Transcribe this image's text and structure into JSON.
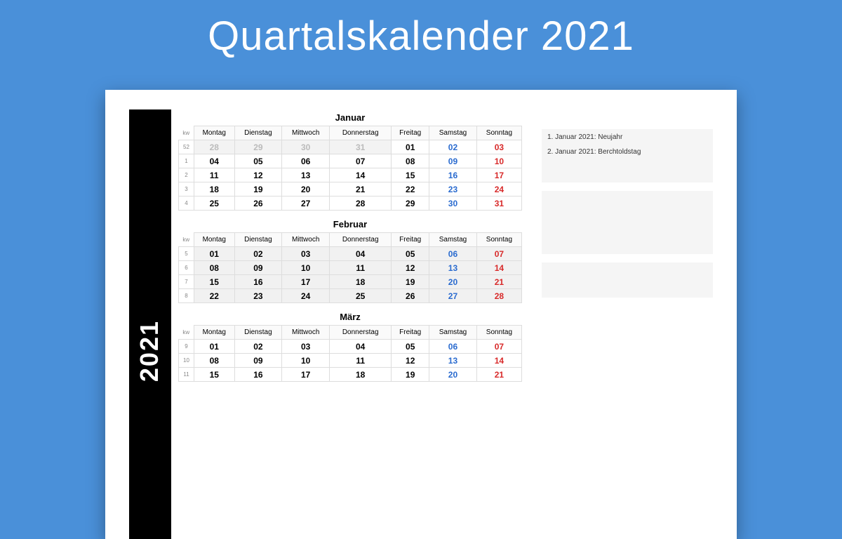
{
  "title": "Quartalskalender 2021",
  "year": "2021",
  "kw_label": "kw",
  "weekdays": [
    "Montag",
    "Dienstag",
    "Mittwoch",
    "Donnerstag",
    "Freitag",
    "Samstag",
    "Sonntag"
  ],
  "months": [
    {
      "name": "Januar",
      "weeks": [
        {
          "kw": "52",
          "days": [
            {
              "n": "28",
              "cls": "grey"
            },
            {
              "n": "29",
              "cls": "grey"
            },
            {
              "n": "30",
              "cls": "grey"
            },
            {
              "n": "31",
              "cls": "grey"
            },
            {
              "n": "01",
              "cls": ""
            },
            {
              "n": "02",
              "cls": "sat"
            },
            {
              "n": "03",
              "cls": "sun"
            }
          ]
        },
        {
          "kw": "1",
          "days": [
            {
              "n": "04",
              "cls": ""
            },
            {
              "n": "05",
              "cls": ""
            },
            {
              "n": "06",
              "cls": ""
            },
            {
              "n": "07",
              "cls": ""
            },
            {
              "n": "08",
              "cls": ""
            },
            {
              "n": "09",
              "cls": "sat"
            },
            {
              "n": "10",
              "cls": "sun"
            }
          ]
        },
        {
          "kw": "2",
          "days": [
            {
              "n": "11",
              "cls": ""
            },
            {
              "n": "12",
              "cls": ""
            },
            {
              "n": "13",
              "cls": ""
            },
            {
              "n": "14",
              "cls": ""
            },
            {
              "n": "15",
              "cls": ""
            },
            {
              "n": "16",
              "cls": "sat"
            },
            {
              "n": "17",
              "cls": "sun"
            }
          ]
        },
        {
          "kw": "3",
          "days": [
            {
              "n": "18",
              "cls": ""
            },
            {
              "n": "19",
              "cls": ""
            },
            {
              "n": "20",
              "cls": ""
            },
            {
              "n": "21",
              "cls": ""
            },
            {
              "n": "22",
              "cls": ""
            },
            {
              "n": "23",
              "cls": "sat"
            },
            {
              "n": "24",
              "cls": "sun"
            }
          ]
        },
        {
          "kw": "4",
          "days": [
            {
              "n": "25",
              "cls": ""
            },
            {
              "n": "26",
              "cls": ""
            },
            {
              "n": "27",
              "cls": ""
            },
            {
              "n": "28",
              "cls": ""
            },
            {
              "n": "29",
              "cls": ""
            },
            {
              "n": "30",
              "cls": "sat"
            },
            {
              "n": "31",
              "cls": "sun"
            }
          ]
        }
      ],
      "notes": [
        "1. Januar 2021: Neujahr",
        "2. Januar 2021: Berchtoldstag"
      ]
    },
    {
      "name": "Februar",
      "shaded": true,
      "weeks": [
        {
          "kw": "5",
          "days": [
            {
              "n": "01",
              "cls": ""
            },
            {
              "n": "02",
              "cls": ""
            },
            {
              "n": "03",
              "cls": ""
            },
            {
              "n": "04",
              "cls": ""
            },
            {
              "n": "05",
              "cls": ""
            },
            {
              "n": "06",
              "cls": "sat"
            },
            {
              "n": "07",
              "cls": "sun"
            }
          ]
        },
        {
          "kw": "6",
          "days": [
            {
              "n": "08",
              "cls": ""
            },
            {
              "n": "09",
              "cls": ""
            },
            {
              "n": "10",
              "cls": ""
            },
            {
              "n": "11",
              "cls": ""
            },
            {
              "n": "12",
              "cls": ""
            },
            {
              "n": "13",
              "cls": "sat"
            },
            {
              "n": "14",
              "cls": "sun"
            }
          ]
        },
        {
          "kw": "7",
          "days": [
            {
              "n": "15",
              "cls": ""
            },
            {
              "n": "16",
              "cls": ""
            },
            {
              "n": "17",
              "cls": ""
            },
            {
              "n": "18",
              "cls": ""
            },
            {
              "n": "19",
              "cls": ""
            },
            {
              "n": "20",
              "cls": "sat"
            },
            {
              "n": "21",
              "cls": "sun"
            }
          ]
        },
        {
          "kw": "8",
          "days": [
            {
              "n": "22",
              "cls": ""
            },
            {
              "n": "23",
              "cls": ""
            },
            {
              "n": "24",
              "cls": ""
            },
            {
              "n": "25",
              "cls": ""
            },
            {
              "n": "26",
              "cls": ""
            },
            {
              "n": "27",
              "cls": "sat"
            },
            {
              "n": "28",
              "cls": "sun"
            }
          ]
        }
      ],
      "notes": []
    },
    {
      "name": "März",
      "weeks": [
        {
          "kw": "9",
          "days": [
            {
              "n": "01",
              "cls": ""
            },
            {
              "n": "02",
              "cls": ""
            },
            {
              "n": "03",
              "cls": ""
            },
            {
              "n": "04",
              "cls": ""
            },
            {
              "n": "05",
              "cls": ""
            },
            {
              "n": "06",
              "cls": "sat"
            },
            {
              "n": "07",
              "cls": "sun"
            }
          ]
        },
        {
          "kw": "10",
          "days": [
            {
              "n": "08",
              "cls": ""
            },
            {
              "n": "09",
              "cls": ""
            },
            {
              "n": "10",
              "cls": ""
            },
            {
              "n": "11",
              "cls": ""
            },
            {
              "n": "12",
              "cls": ""
            },
            {
              "n": "13",
              "cls": "sat"
            },
            {
              "n": "14",
              "cls": "sun"
            }
          ]
        },
        {
          "kw": "11",
          "days": [
            {
              "n": "15",
              "cls": ""
            },
            {
              "n": "16",
              "cls": ""
            },
            {
              "n": "17",
              "cls": ""
            },
            {
              "n": "18",
              "cls": ""
            },
            {
              "n": "19",
              "cls": ""
            },
            {
              "n": "20",
              "cls": "sat"
            },
            {
              "n": "21",
              "cls": "sun"
            }
          ]
        }
      ],
      "notes": []
    }
  ]
}
